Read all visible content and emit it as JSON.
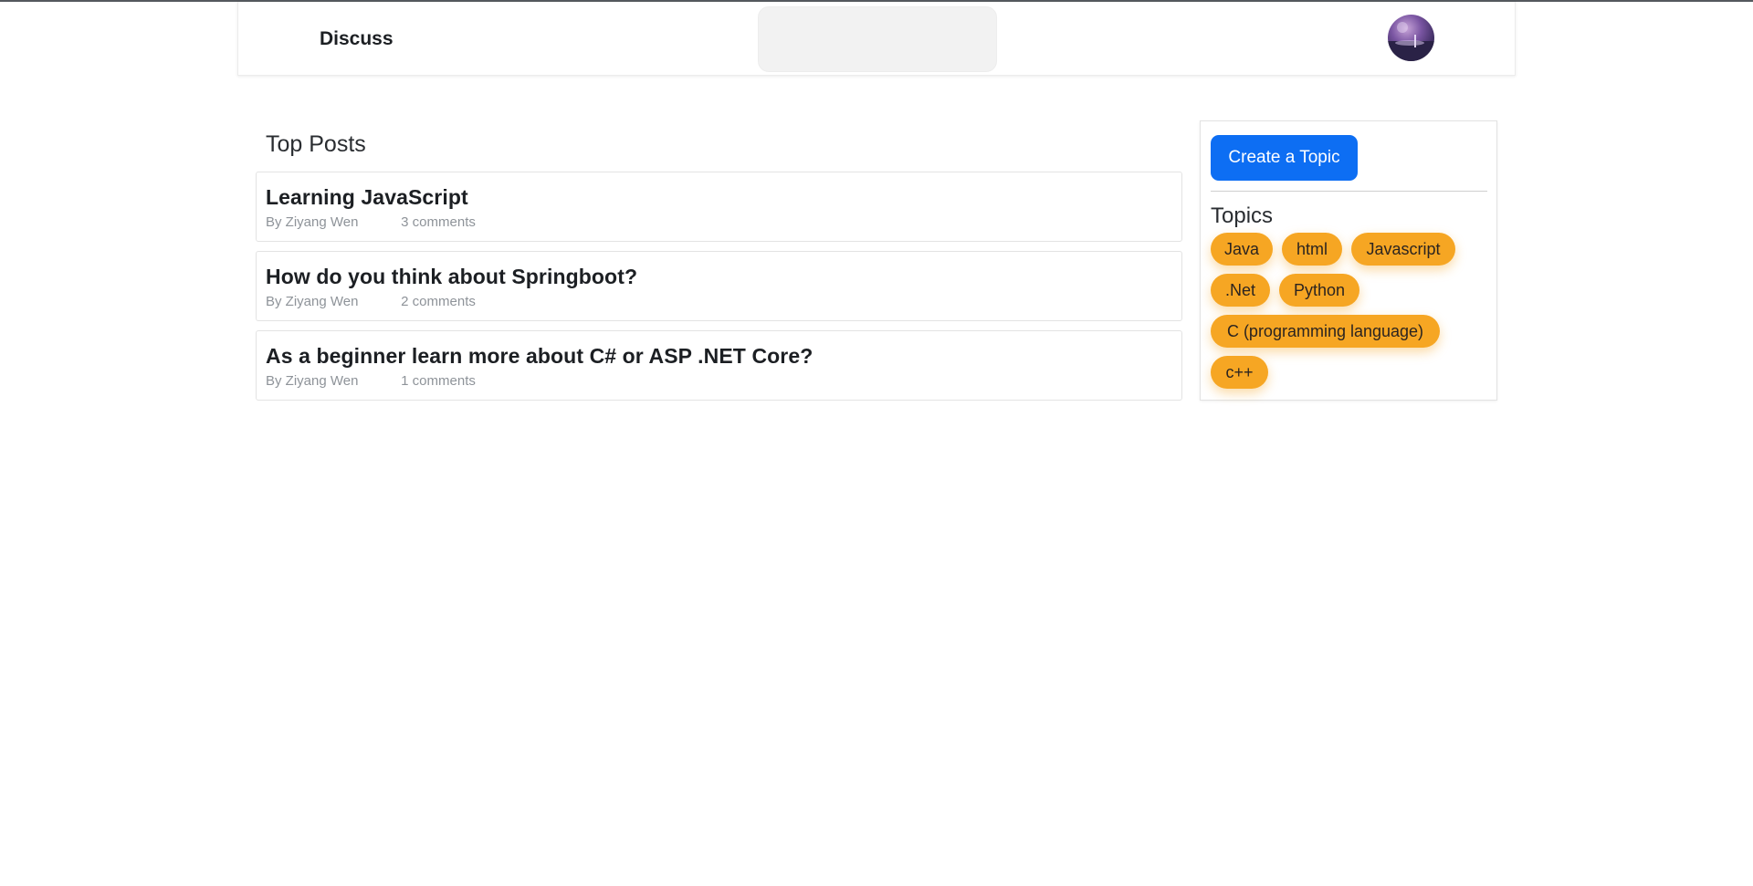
{
  "nav": {
    "brand": "Discuss",
    "search_placeholder": "",
    "avatar_icon": "user-avatar"
  },
  "main": {
    "title": "Top Posts",
    "posts": [
      {
        "title": "Learning JavaScript",
        "author": "By Ziyang Wen",
        "comments": "3 comments"
      },
      {
        "title": "How do you think about Springboot?",
        "author": "By Ziyang Wen",
        "comments": "2 comments"
      },
      {
        "title": "As a beginner learn more about C# or ASP .NET Core?",
        "author": "By Ziyang Wen",
        "comments": "1 comments"
      }
    ]
  },
  "sidebar": {
    "create_label": "Create a Topic",
    "topics_title": "Topics",
    "topics": [
      "Java",
      "html",
      "Javascript",
      ".Net",
      "Python",
      "C (programming language)",
      "c++"
    ]
  },
  "colors": {
    "accent_blue": "#0d6ef3",
    "topic_orange": "#f6a623"
  }
}
